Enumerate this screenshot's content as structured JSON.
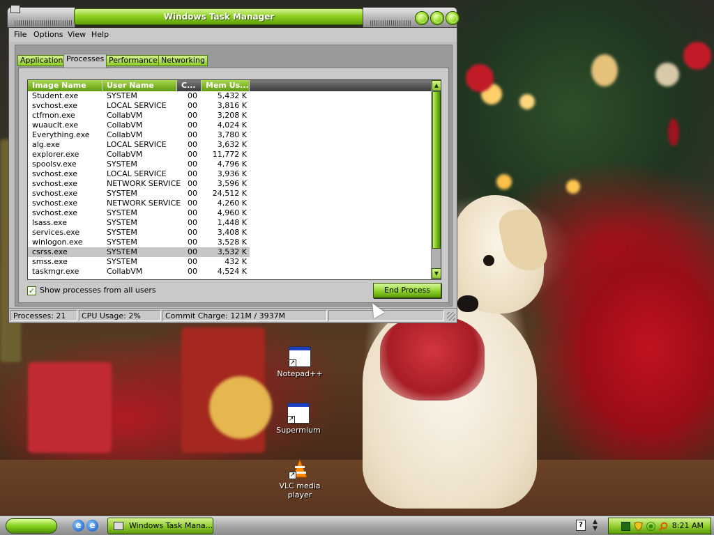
{
  "window": {
    "title": "Windows Task Manager",
    "menu": [
      "File",
      "Options",
      "View",
      "Help"
    ],
    "tabs": [
      "Applications",
      "Processes",
      "Performance",
      "Networking"
    ],
    "active_tab": "Processes"
  },
  "process_table": {
    "headers": [
      "Image Name",
      "User Name",
      "C...",
      "Mem Us..."
    ],
    "rows": [
      {
        "name": "Student.exe",
        "user": "SYSTEM",
        "cpu": "00",
        "mem": "5,432 K"
      },
      {
        "name": "svchost.exe",
        "user": "LOCAL SERVICE",
        "cpu": "00",
        "mem": "3,816 K"
      },
      {
        "name": "ctfmon.exe",
        "user": "CollabVM",
        "cpu": "00",
        "mem": "3,208 K"
      },
      {
        "name": "wuauclt.exe",
        "user": "CollabVM",
        "cpu": "00",
        "mem": "4,024 K"
      },
      {
        "name": "Everything.exe",
        "user": "CollabVM",
        "cpu": "00",
        "mem": "3,780 K"
      },
      {
        "name": "alg.exe",
        "user": "LOCAL SERVICE",
        "cpu": "00",
        "mem": "3,632 K"
      },
      {
        "name": "explorer.exe",
        "user": "CollabVM",
        "cpu": "00",
        "mem": "11,772 K"
      },
      {
        "name": "spoolsv.exe",
        "user": "SYSTEM",
        "cpu": "00",
        "mem": "4,796 K"
      },
      {
        "name": "svchost.exe",
        "user": "LOCAL SERVICE",
        "cpu": "00",
        "mem": "3,936 K"
      },
      {
        "name": "svchost.exe",
        "user": "NETWORK SERVICE",
        "cpu": "00",
        "mem": "3,596 K"
      },
      {
        "name": "svchost.exe",
        "user": "SYSTEM",
        "cpu": "00",
        "mem": "24,512 K"
      },
      {
        "name": "svchost.exe",
        "user": "NETWORK SERVICE",
        "cpu": "00",
        "mem": "4,260 K"
      },
      {
        "name": "svchost.exe",
        "user": "SYSTEM",
        "cpu": "00",
        "mem": "4,960 K"
      },
      {
        "name": "lsass.exe",
        "user": "SYSTEM",
        "cpu": "00",
        "mem": "1,448 K"
      },
      {
        "name": "services.exe",
        "user": "SYSTEM",
        "cpu": "00",
        "mem": "3,408 K"
      },
      {
        "name": "winlogon.exe",
        "user": "SYSTEM",
        "cpu": "00",
        "mem": "3,528 K"
      },
      {
        "name": "csrss.exe",
        "user": "SYSTEM",
        "cpu": "00",
        "mem": "3,532 K",
        "selected": true
      },
      {
        "name": "smss.exe",
        "user": "SYSTEM",
        "cpu": "00",
        "mem": "432 K"
      },
      {
        "name": "taskmgr.exe",
        "user": "CollabVM",
        "cpu": "00",
        "mem": "4,524 K"
      }
    ]
  },
  "controls": {
    "show_all_users_label": "Show processes from all users",
    "show_all_users_checked": true,
    "end_process_label": "End Process"
  },
  "statusbar": {
    "processes": "Processes: 21",
    "cpu_usage": "CPU Usage: 2%",
    "commit_charge": "Commit Charge: 121M / 3937M"
  },
  "desktop_icons": [
    {
      "label": "Notepad++",
      "icon": "notepadpp-icon"
    },
    {
      "label": "Supermium",
      "icon": "supermium-icon"
    },
    {
      "label": "VLC media player",
      "icon": "vlc-icon"
    }
  ],
  "taskbar": {
    "task_button_label": "Windows Task Mana...",
    "clock": "8:21 AM"
  },
  "colors": {
    "accent_green": "#8ecb2a",
    "accent_green_dark": "#305a00",
    "selection_gray": "#c6c6c6"
  }
}
